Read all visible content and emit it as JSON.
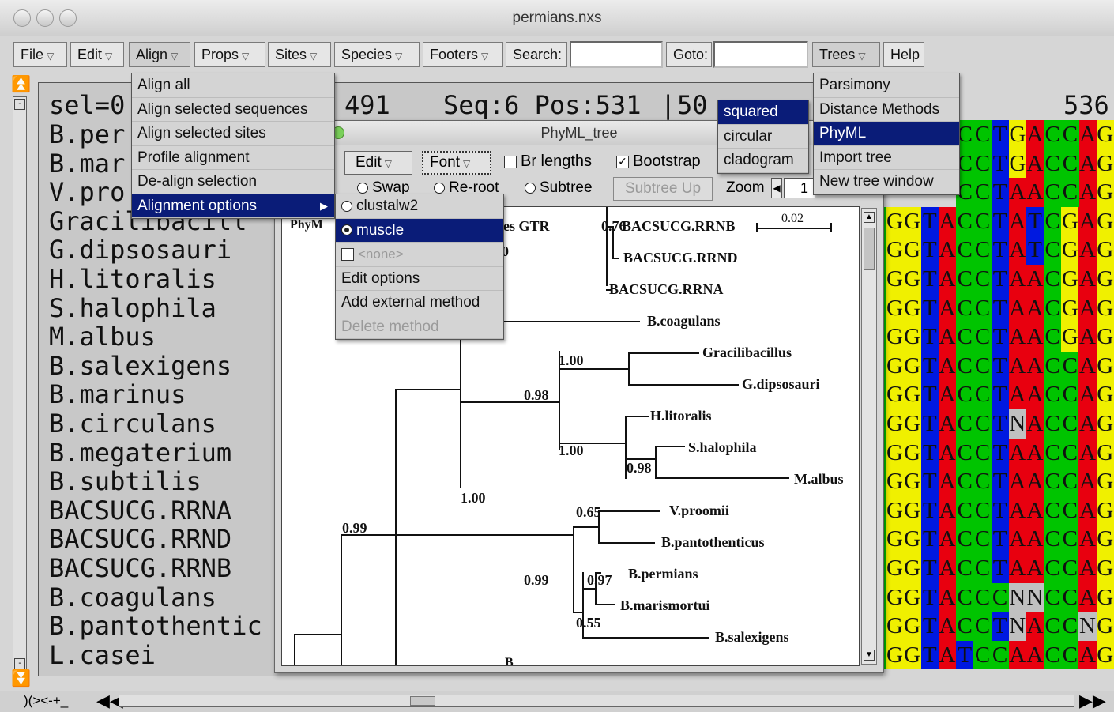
{
  "window": {
    "title": "permians.nxs"
  },
  "toolbar": {
    "file": "File",
    "edit": "Edit",
    "align": "Align",
    "props": "Props",
    "sites": "Sites",
    "species": "Species",
    "footers": "Footers",
    "search_label": "Search:",
    "goto_label": "Goto:",
    "trees": "Trees",
    "help": "Help",
    "search_value": "",
    "goto_value": ""
  },
  "header": {
    "sel": "sel=0",
    "count": "491",
    "seq": "Seq:6 Pos:531",
    "sep": "|",
    "pos2": "50",
    "right": "536"
  },
  "names": [
    "B.per",
    "B.mar",
    "V.pro",
    "Gracilibacill",
    "G.dipsosauri",
    "H.litoralis",
    "S.halophila",
    "M.albus",
    "B.salexigens",
    "B.marinus",
    "B.circulans",
    "B.megaterium",
    "B.subtilis",
    "BACSUCG.RRNA",
    "BACSUCG.RRND",
    "BACSUCG.RRNB",
    "B.coagulans",
    "B.pantothentic",
    "L.casei"
  ],
  "sequences": [
    "CCTGACCAG",
    "CCTGACCAG",
    "CCTAACCAG",
    "CGGTACCTATCGAG",
    "CGGTACCTATCGAG",
    "CGGTACCTAACGAG",
    "CGGTACCTAACGAG",
    "CGGTACCTAACGAG",
    "CGGTACCTAACCAG",
    "CGGTACCTAACCAG",
    "CGGTACCTNACCAG",
    "CGGTACCTAACCAG",
    "CGGTACCTAACCAG",
    "CGGTACCTAACCAG",
    "CGGTACCTAACCAG",
    "CGGTACCTAACCAG",
    "CGGTACCCNNCCAG",
    "CGGTACCTNACCNG",
    "CGGTATCCAACCAG"
  ],
  "align_menu": [
    "Align all",
    "Align selected sequences",
    "Align selected sites",
    "Profile alignment",
    "De-align selection",
    "Alignment options"
  ],
  "align_options_menu": [
    "clustalw2",
    "muscle",
    "<none>",
    "Edit options",
    "Add external method",
    "Delete method"
  ],
  "trees_menu": [
    "Parsimony",
    "Distance Methods",
    "PhyML",
    "Import tree",
    "New tree window"
  ],
  "tree_shape_menu": [
    "squared",
    "circular",
    "cladogram"
  ],
  "phyml": {
    "title": "PhyML_tree",
    "edit": "Edit",
    "font": "Font",
    "br_lengths": "Br lengths",
    "bootstrap": "Bootstrap",
    "swap": "Swap",
    "reroot": "Re-root",
    "subtree": "Subtree",
    "subtree_up": "Subtree Up",
    "zoom_label": "Zoom",
    "zoom_value": "1",
    "tree_title_left": "PhyM",
    "tree_title_right": "es GTR",
    "scale_label": "0.02",
    "bs_top": "0.76",
    "bs_zero": "0"
  },
  "tree": {
    "leaves": [
      "BACSUCG.RRNB",
      "BACSUCG.RRND",
      "BACSUCG.RRNA",
      "B.coagulans",
      "Gracilibacillus",
      "G.dipsosauri",
      "H.litoralis",
      "S.halophila",
      "M.albus",
      "V.proomii",
      "B.pantothenticus",
      "B.permians",
      "B.marismortui",
      "B.salexigens"
    ],
    "support": [
      "1.00",
      "0.98",
      "1.00",
      "0.98",
      "1.00",
      "0.99",
      "0.65",
      "0.99",
      "0.97",
      "0.55"
    ],
    "cut_label": "B"
  },
  "bottom": {
    "left_text": ")(><-+_"
  },
  "colors": {
    "A": "#e8000f",
    "C": "#00c400",
    "G": "#f0f000",
    "T": "#0019e0",
    "N": "#c0c0c0",
    "highlight": "#0a1c78"
  }
}
